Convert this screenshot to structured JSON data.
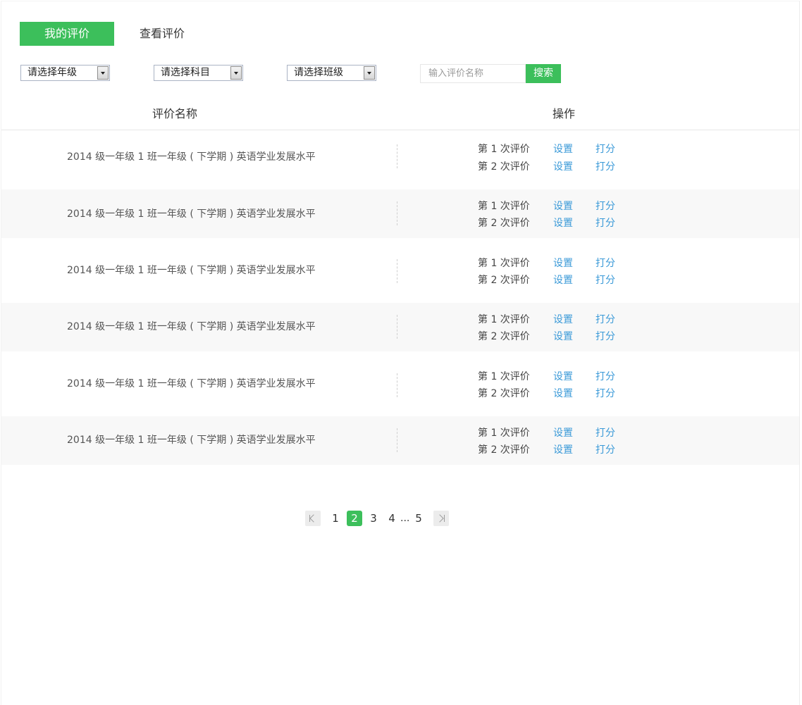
{
  "tabs": [
    {
      "label": "我的评价",
      "active": true
    },
    {
      "label": "查看评价",
      "active": false
    }
  ],
  "filters": {
    "grade": "请选择年级",
    "subject": "请选择科目",
    "class": "请选择班级",
    "search_placeholder": "输入评价名称",
    "search_button": "搜索"
  },
  "table": {
    "headers": {
      "name": "评价名称",
      "operation": "操作"
    },
    "rows": [
      {
        "name": "2014 级一年级 1 班一年级 ( 下学期 ) 英语学业发展水平",
        "evals": [
          {
            "label": "第 1 次评价",
            "set": "设置",
            "score": "打分"
          },
          {
            "label": "第 2 次评价",
            "set": "设置",
            "score": "打分"
          }
        ]
      },
      {
        "name": "2014 级一年级 1 班一年级 ( 下学期 ) 英语学业发展水平",
        "evals": [
          {
            "label": "第 1 次评价",
            "set": "设置",
            "score": "打分"
          },
          {
            "label": "第 2 次评价",
            "set": "设置",
            "score": "打分"
          }
        ]
      },
      {
        "name": "2014 级一年级 1 班一年级 ( 下学期 ) 英语学业发展水平",
        "evals": [
          {
            "label": "第 1 次评价",
            "set": "设置",
            "score": "打分"
          },
          {
            "label": "第 2 次评价",
            "set": "设置",
            "score": "打分"
          }
        ]
      },
      {
        "name": "2014 级一年级 1 班一年级 ( 下学期 ) 英语学业发展水平",
        "evals": [
          {
            "label": "第 1 次评价",
            "set": "设置",
            "score": "打分"
          },
          {
            "label": "第 2 次评价",
            "set": "设置",
            "score": "打分"
          }
        ]
      },
      {
        "name": "2014 级一年级 1 班一年级 ( 下学期 ) 英语学业发展水平",
        "evals": [
          {
            "label": "第 1 次评价",
            "set": "设置",
            "score": "打分"
          },
          {
            "label": "第 2 次评价",
            "set": "设置",
            "score": "打分"
          }
        ]
      },
      {
        "name": "2014 级一年级 1 班一年级 ( 下学期 ) 英语学业发展水平",
        "evals": [
          {
            "label": "第 1 次评价",
            "set": "设置",
            "score": "打分"
          },
          {
            "label": "第 2 次评价",
            "set": "设置",
            "score": "打分"
          }
        ]
      }
    ]
  },
  "pagination": {
    "pages": [
      "1",
      "2",
      "3",
      "4",
      "5"
    ],
    "current": "2",
    "ellipsis": "..."
  },
  "colors": {
    "accent": "#3cbf5b",
    "link": "#3b9ad8",
    "alt_row": "#f8f8f8"
  }
}
